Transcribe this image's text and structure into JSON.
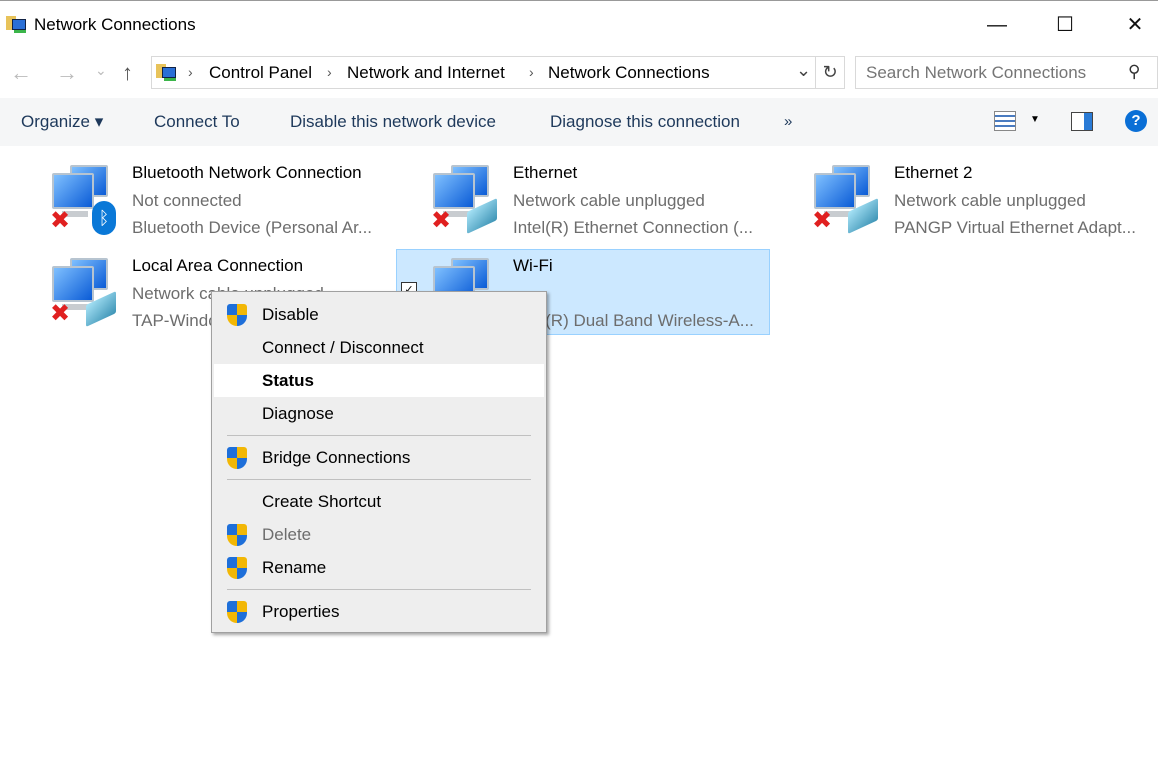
{
  "window": {
    "title": "Network Connections",
    "minimize": "—",
    "maximize": "☐",
    "close": "✕"
  },
  "nav": {
    "back": "←",
    "forward": "→",
    "recent": "⌄",
    "up": "↑"
  },
  "address": {
    "crumbs": [
      "Control Panel",
      "Network and Internet",
      "Network Connections"
    ],
    "sep": "›",
    "dropdown": "⌄",
    "refresh": "↻"
  },
  "search": {
    "placeholder": "Search Network Connections",
    "icon": "⚲"
  },
  "toolbar": {
    "organize": "Organize ▾",
    "connect_to": "Connect To",
    "disable": "Disable this network device",
    "diagnose": "Diagnose this connection",
    "more": "»",
    "help": "?"
  },
  "connections": [
    {
      "name": "Bluetooth Network Connection",
      "status": "Not connected",
      "device": "Bluetooth Device (Personal Ar..."
    },
    {
      "name": "Ethernet",
      "status": "Network cable unplugged",
      "device": "Intel(R) Ethernet Connection (..."
    },
    {
      "name": "Ethernet 2",
      "status": "Network cable unplugged",
      "device": "PANGP Virtual Ethernet Adapt..."
    },
    {
      "name": "Local Area Connection",
      "status": "Network cable unplugged",
      "device": "TAP-Windows Adapter V9"
    },
    {
      "name": "Wi-Fi",
      "status": "",
      "device": "Intel(R) Dual Band Wireless-A..."
    }
  ],
  "context_menu": {
    "items": [
      "Disable",
      "Connect / Disconnect",
      "Status",
      "Diagnose",
      "Bridge Connections",
      "Create Shortcut",
      "Delete",
      "Rename",
      "Properties"
    ],
    "highlighted": "Status",
    "disabled": [
      "Delete"
    ]
  },
  "colors": {
    "selection": "#cce8ff",
    "toolbar_text": "#1e395b",
    "help": "#0a6fd6"
  }
}
